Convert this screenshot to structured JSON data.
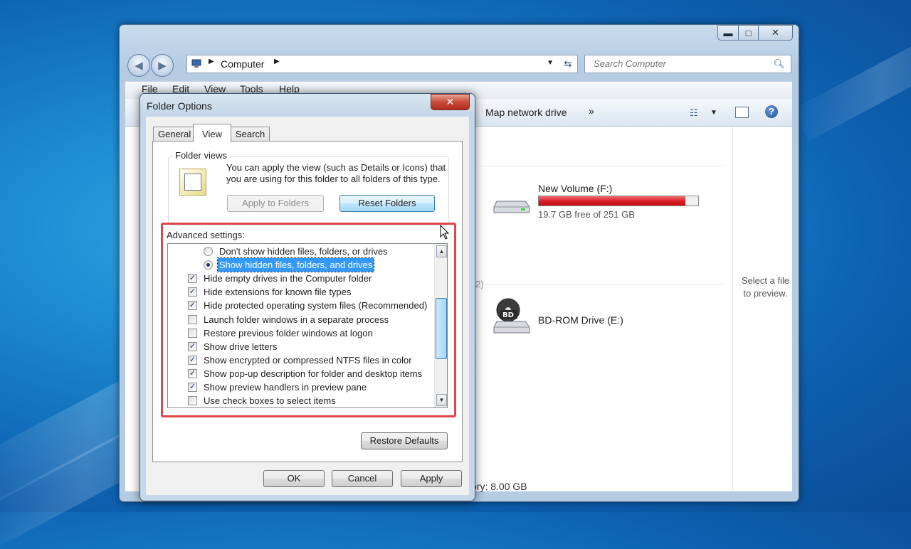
{
  "explorer": {
    "window_buttons": {
      "min": "▬",
      "max": "□",
      "close": "✕"
    },
    "nav": {
      "back_icon": "back-arrow-icon",
      "forward_icon": "forward-arrow-icon"
    },
    "address": {
      "crumb": "Computer"
    },
    "search": {
      "placeholder": "Search Computer"
    },
    "menu": [
      "File",
      "Edit",
      "View",
      "Tools",
      "Help"
    ],
    "command_bar": {
      "map_network_drive": "Map network drive",
      "more": "»"
    },
    "drives": [
      {
        "name": "New Volume (F:)",
        "free_text": "19.7 GB free of 251 GB",
        "used_fraction": 0.92
      },
      {
        "name": "BD-ROM Drive (E:)"
      }
    ],
    "partial_texts": {
      "group_count": "2)",
      "memory": "ory: 8.00 GB"
    },
    "preview_text": "Select a file to preview."
  },
  "dialog": {
    "title": "Folder Options",
    "close_label": "✕",
    "tabs": [
      {
        "label": "General",
        "active": false
      },
      {
        "label": "View",
        "active": true
      },
      {
        "label": "Search",
        "active": false
      }
    ],
    "folder_views": {
      "label": "Folder views",
      "description": "You can apply the view (such as Details or Icons) that you are using for this folder to all folders of this type.",
      "apply_button": "Apply to Folders",
      "reset_button": "Reset Folders"
    },
    "advanced": {
      "label": "Advanced settings:",
      "items": [
        {
          "type": "radio",
          "label": "Don't show hidden files, folders, or drives",
          "checked": false,
          "indent": 2
        },
        {
          "type": "radio",
          "label": "Show hidden files, folders, and drives",
          "checked": true,
          "indent": 2,
          "selected": true
        },
        {
          "type": "checkbox",
          "label": "Hide empty drives in the Computer folder",
          "checked": true,
          "indent": 1
        },
        {
          "type": "checkbox",
          "label": "Hide extensions for known file types",
          "checked": true,
          "indent": 1
        },
        {
          "type": "checkbox",
          "label": "Hide protected operating system files (Recommended)",
          "checked": true,
          "indent": 1
        },
        {
          "type": "checkbox",
          "label": "Launch folder windows in a separate process",
          "checked": false,
          "indent": 1
        },
        {
          "type": "checkbox",
          "label": "Restore previous folder windows at logon",
          "checked": false,
          "indent": 1
        },
        {
          "type": "checkbox",
          "label": "Show drive letters",
          "checked": true,
          "indent": 1
        },
        {
          "type": "checkbox",
          "label": "Show encrypted or compressed NTFS files in color",
          "checked": true,
          "indent": 1
        },
        {
          "type": "checkbox",
          "label": "Show pop-up description for folder and desktop items",
          "checked": true,
          "indent": 1
        },
        {
          "type": "checkbox",
          "label": "Show preview handlers in preview pane",
          "checked": true,
          "indent": 1
        },
        {
          "type": "checkbox",
          "label": "Use check boxes to select items",
          "checked": false,
          "indent": 1
        }
      ]
    },
    "restore_defaults": "Restore Defaults",
    "buttons": {
      "ok": "OK",
      "cancel": "Cancel",
      "apply": "Apply"
    }
  },
  "colors": {
    "highlight_box": "#e0454a",
    "selection": "#3399ff",
    "drive_bar": "#d71c24"
  }
}
